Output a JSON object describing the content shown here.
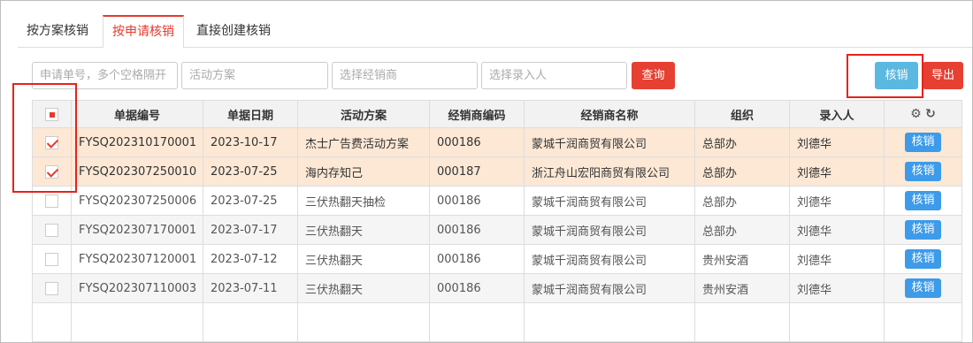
{
  "tabs": [
    {
      "label": "按方案核销"
    },
    {
      "label": "按申请核销"
    },
    {
      "label": "直接创建核销"
    }
  ],
  "active_tab": 1,
  "filters": {
    "apply_no_placeholder": "申请单号，多个空格隔开",
    "activity_placeholder": "活动方案",
    "dealer_placeholder": "选择经销商",
    "entry_user_placeholder": "选择录入人",
    "query_label": "查询"
  },
  "toolbar": {
    "writeoff_label": "核销",
    "export_label": "导出"
  },
  "table": {
    "columns": [
      "单据编号",
      "单据日期",
      "活动方案",
      "经销商编码",
      "经销商名称",
      "组织",
      "录入人"
    ],
    "action_label": "核销",
    "rows": [
      {
        "no": "FYSQ202310170001",
        "date": "2023-10-17",
        "plan": "杰士广告费活动方案",
        "dealer_code": "000186",
        "dealer_name": "蒙城千润商贸有限公司",
        "org": "总部办",
        "user": "刘德华",
        "checked": true
      },
      {
        "no": "FYSQ202307250010",
        "date": "2023-07-25",
        "plan": "海内存知己",
        "dealer_code": "000187",
        "dealer_name": "浙江舟山宏阳商贸有限公司",
        "org": "总部办",
        "user": "刘德华",
        "checked": true
      },
      {
        "no": "FYSQ202307250006",
        "date": "2023-07-25",
        "plan": "三伏热翻天抽检",
        "dealer_code": "000186",
        "dealer_name": "蒙城千润商贸有限公司",
        "org": "总部办",
        "user": "刘德华",
        "checked": false
      },
      {
        "no": "FYSQ202307170001",
        "date": "2023-07-17",
        "plan": "三伏热翻天",
        "dealer_code": "000186",
        "dealer_name": "蒙城千润商贸有限公司",
        "org": "总部办",
        "user": "刘德华",
        "checked": false
      },
      {
        "no": "FYSQ202307120001",
        "date": "2023-07-12",
        "plan": "三伏热翻天",
        "dealer_code": "000186",
        "dealer_name": "蒙城千润商贸有限公司",
        "org": "贵州安酒",
        "user": "刘德华",
        "checked": false
      },
      {
        "no": "FYSQ202307110003",
        "date": "2023-07-11",
        "plan": "三伏热翻天",
        "dealer_code": "000186",
        "dealer_name": "蒙城千润商贸有限公司",
        "org": "贵州安酒",
        "user": "刘德华",
        "checked": false
      }
    ]
  },
  "colors": {
    "accent_red": "#e43b2f",
    "selected_row_bg": "#fce8d5",
    "action_blue": "#3d9be9",
    "writeoff_blue": "#5bb8e0"
  }
}
